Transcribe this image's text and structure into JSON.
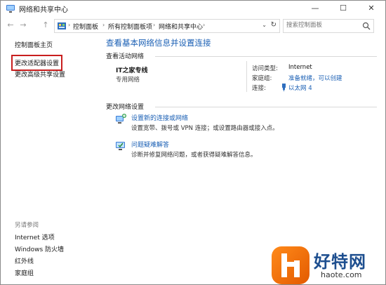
{
  "window": {
    "title": "网络和共享中心",
    "controls": {
      "minimize": "—",
      "maximize": "☐",
      "close": "✕"
    }
  },
  "nav": {
    "back": "←",
    "forward": "→",
    "up": "↑"
  },
  "address": {
    "breadcrumbs": [
      "控制面板",
      "所有控制面板项",
      "网络和共享中心"
    ],
    "leading_sep": "›",
    "separator": "›",
    "dropdown": "⌄",
    "refresh": "↻"
  },
  "search": {
    "placeholder": "搜索控制面板"
  },
  "sidebar": {
    "links": [
      "控制面板主页",
      "更改适配器设置",
      "更改高级共享设置"
    ],
    "see_also_label": "另请参阅",
    "see_also": [
      "Internet 选项",
      "Windows 防火墙",
      "红外线",
      "家庭组"
    ]
  },
  "main": {
    "title": "查看基本网络信息并设置连接",
    "active_networks_heading": "查看活动网络",
    "network": {
      "name": "IT之家专线",
      "type": "专用网络",
      "access_type_label": "访问类型:",
      "access_type_value": "Internet",
      "homegroup_label": "家庭组:",
      "homegroup_value": "准备就绪，可以创建",
      "connections_label": "连接:",
      "connections_value": "以太网 4"
    },
    "change_settings_heading": "更改网络设置",
    "tasks": [
      {
        "link": "设置新的连接或网络",
        "desc": "设置宽带、拨号或 VPN 连接；或设置路由器或接入点。"
      },
      {
        "link": "问题疑难解答",
        "desc": "诊断并修复网络问题，或者获得疑难解答信息。"
      }
    ]
  },
  "watermark": {
    "logo_char": "h",
    "text": "好特网",
    "url": "haote.com"
  },
  "colors": {
    "link": "#1a5fb4",
    "highlight_box": "#c81e1e"
  }
}
